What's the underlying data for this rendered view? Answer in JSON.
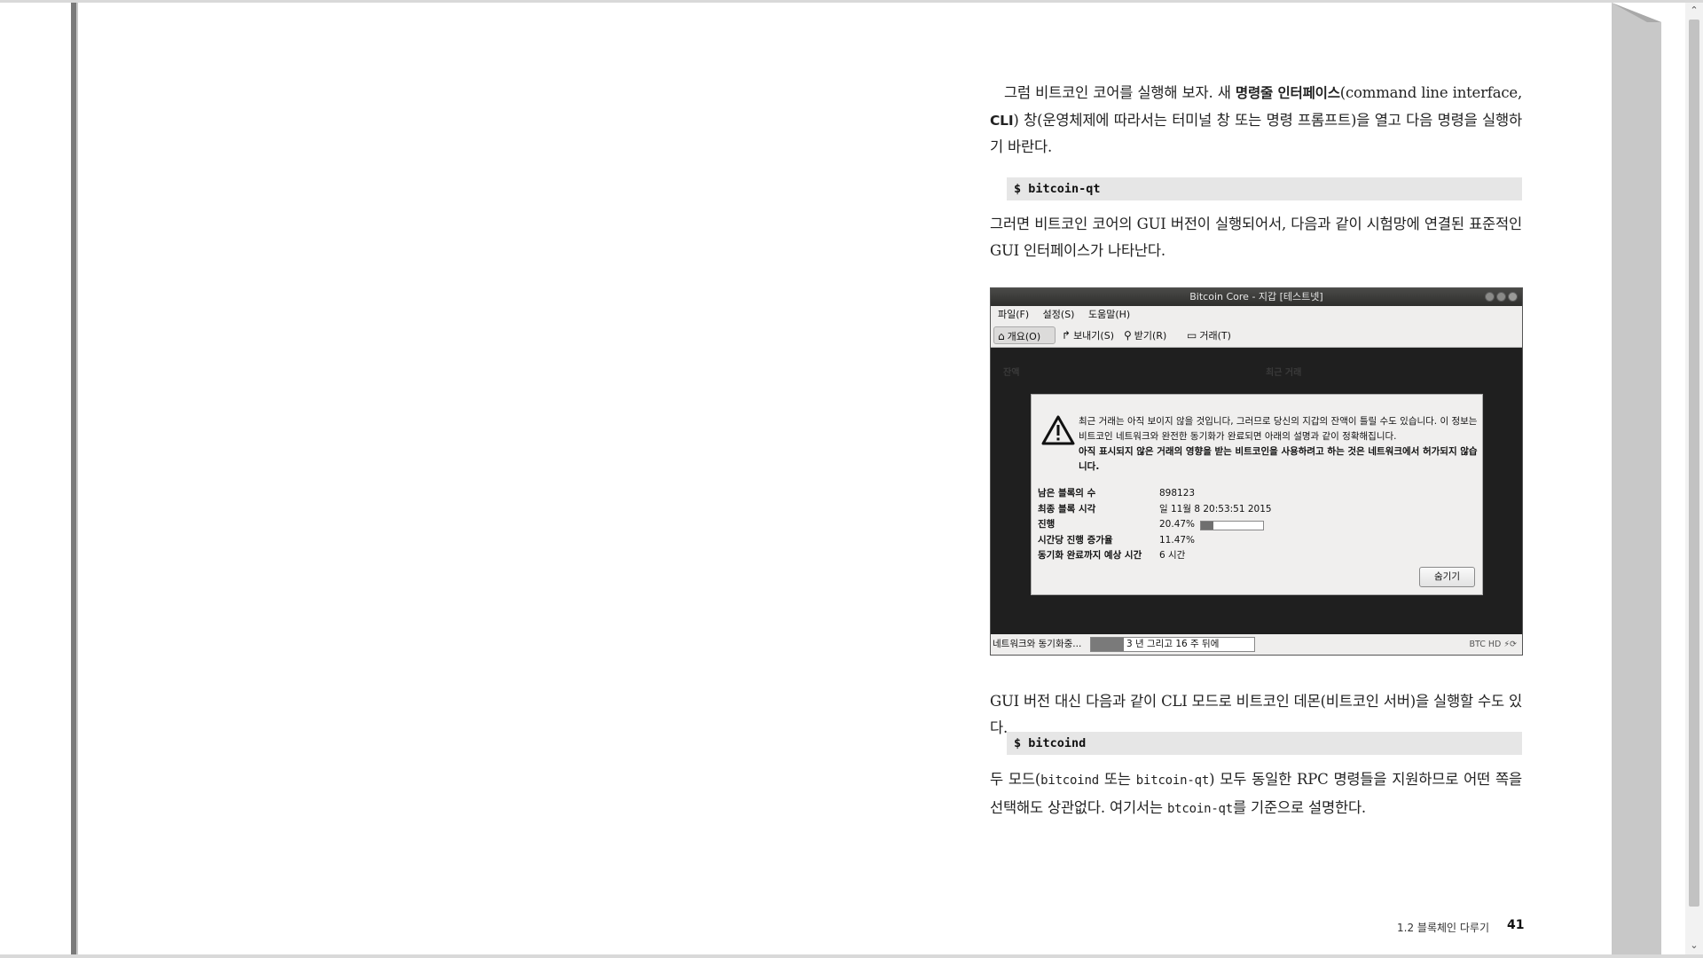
{
  "paragraphs": {
    "p1_a": "그럼 비트코인 코어를 실행해 보자. 새 ",
    "p1_bold1": "명령줄 인터페이스",
    "p1_b": "(command line interface, ",
    "p1_bold2": "CLI",
    "p1_c": ") 창(운영체제에 따라서는 터미널 창 또는 명령 프롬프트)을 열고 다음 명령을 실행하기 바란다.",
    "code1": "$ bitcoin-qt",
    "p2": "그러면 비트코인 코어의 GUI 버전이 실행되어서, 다음과 같이 시험망에 연결된 표준적인 GUI 인터페이스가 나타난다.",
    "p3": "GUI 버전 대신 다음과 같이 CLI 모드로 비트코인 데몬(비트코인 서버)을 실행할 수도 있다.",
    "code2": "$ bitcoind",
    "p4_a": "두 모드(",
    "p4_code1": "bitcoind",
    "p4_b": " 또는 ",
    "p4_code2": "bitcoin-qt",
    "p4_c": ") 모두 동일한 RPC 명령들을 지원하므로 어떤 쪽을 선택해도 상관없다. 여기서는 ",
    "p4_code3": "btcoin-qt",
    "p4_d": "를 기준으로 설명한다."
  },
  "window": {
    "title": "Bitcoin Core - 지갑 [테스트넷]",
    "menu": [
      "파일(F)",
      "설정(S)",
      "도움말(H)"
    ],
    "toolbar": [
      {
        "label": "개요(O)",
        "icon": "home-icon"
      },
      {
        "label": "보내기(S)",
        "icon": "send-arrow-icon"
      },
      {
        "label": "받기(R)",
        "icon": "receive-icon"
      },
      {
        "label": "거래(T)",
        "icon": "card-icon"
      }
    ],
    "ghost": {
      "balance": "잔액",
      "recent": "최근 거래"
    },
    "modal": {
      "msg_normal": "최근 거래는 아직 보이지 않을 것입니다, 그러므로 당신의 지갑의 잔액이 틀릴 수도 있습니다. 이 정보는 비트코인 네트워크와 완전한 동기화가 완료되면 아래의 설명과 같이 정확해집니다.",
      "msg_bold": "아직 표시되지 않은 거래의 영향을 받는 비트코인을 사용하려고 하는 것은 네트워크에서 허가되지 않습니다.",
      "rows": [
        {
          "key": "남은 블록의 수",
          "value": "898123"
        },
        {
          "key": "최종 블록 시각",
          "value": "일 11월 8 20:53:51 2015"
        },
        {
          "key": "진행",
          "value": "20.47%"
        },
        {
          "key": "시간당 진행 증가율",
          "value": "11.47%"
        },
        {
          "key": "동기화 완료까지 예상 시간",
          "value": "6 시간"
        }
      ],
      "progress_fraction": 0.2047,
      "hide_button": "숨기기"
    },
    "status": {
      "label": "네트워크와 동기화중...",
      "bar_text": "3 년 그리고 16 주 뒤에",
      "bar_fraction": 0.2,
      "right": "BTC HD"
    }
  },
  "footer": {
    "section": "1.2  블록체인 다루기",
    "page": "41"
  }
}
